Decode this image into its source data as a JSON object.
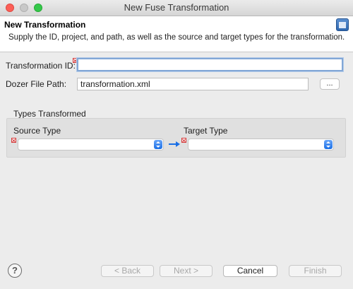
{
  "window": {
    "title": "New Fuse Transformation"
  },
  "header": {
    "title": "New Transformation",
    "description": "Supply the ID, project, and path, as well as the source and target types for the transformation.",
    "icon": "wizard-banner-icon"
  },
  "form": {
    "transformation_id": {
      "label": "Transformation ID:",
      "value": "",
      "has_error": true
    },
    "dozer_file_path": {
      "label": "Dozer File Path:",
      "value": "transformation.xml",
      "browse_label": "..."
    }
  },
  "types_group": {
    "title": "Types Transformed",
    "source": {
      "label": "Source Type",
      "value": "",
      "has_error": true
    },
    "target": {
      "label": "Target Type",
      "value": "",
      "has_error": true
    },
    "arrow_icon": "right-arrow-icon"
  },
  "footer": {
    "help_label": "?",
    "back_label": "< Back",
    "next_label": "Next >",
    "cancel_label": "Cancel",
    "finish_label": "Finish"
  },
  "colors": {
    "accent_blue": "#1a6fe6",
    "error_red": "#d43b3b",
    "focus_ring": "#82a7d6"
  }
}
